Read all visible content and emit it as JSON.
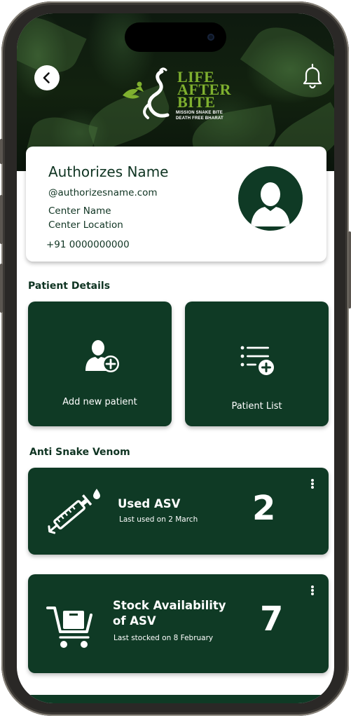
{
  "header": {
    "logo": {
      "words": [
        "LIFE",
        "AFTER",
        "BITE"
      ],
      "tagline_1": "MISSION SNAKE BITE",
      "tagline_2": "DEATH FREE BHARAT",
      "color": "#7fb02f"
    },
    "back_icon": "chevron-left-icon",
    "notification_icon": "bell-icon"
  },
  "profile": {
    "name": "Authorizes Name",
    "email": "@authorizesname.com",
    "center_name": "Center Name",
    "center_location": "Center Location",
    "phone": "+91 0000000000",
    "avatar_icon": "user-silhouette-icon"
  },
  "patient_section": {
    "title": "Patient Details",
    "tiles": [
      {
        "label": "Add new patient",
        "icon": "add-user-icon"
      },
      {
        "label": "Patient List",
        "icon": "list-add-icon"
      }
    ]
  },
  "asv_section": {
    "title": "Anti Snake Venom",
    "cards": [
      {
        "title": "Used ASV",
        "subtitle": "Last used on 2 March",
        "count": "2",
        "icon": "syringe-icon"
      },
      {
        "title_line1": "Stock Availability",
        "title_line2": "of ASV",
        "subtitle": "Last stocked on 8 February",
        "count": "7",
        "icon": "cart-icon"
      }
    ]
  },
  "colors": {
    "primary": "#0f3a25",
    "text": "#0f3422",
    "card_bg": "#ffffff"
  }
}
